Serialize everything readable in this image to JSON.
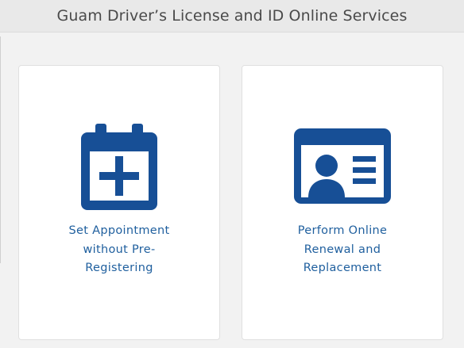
{
  "header": {
    "title": "Guam Driver’s License and ID Online Services"
  },
  "cards": [
    {
      "icon": "calendar-plus-icon",
      "label_lines": [
        "Set Appointment",
        "without Pre-",
        "Registering"
      ]
    },
    {
      "icon": "id-card-icon",
      "label_lines": [
        "Perform Online",
        "Renewal and",
        "Replacement"
      ]
    }
  ],
  "colors": {
    "brand_blue": "#1f5f9e",
    "icon_blue": "#174f96",
    "header_bg": "#e9e9e9",
    "page_bg": "#f2f2f2"
  }
}
